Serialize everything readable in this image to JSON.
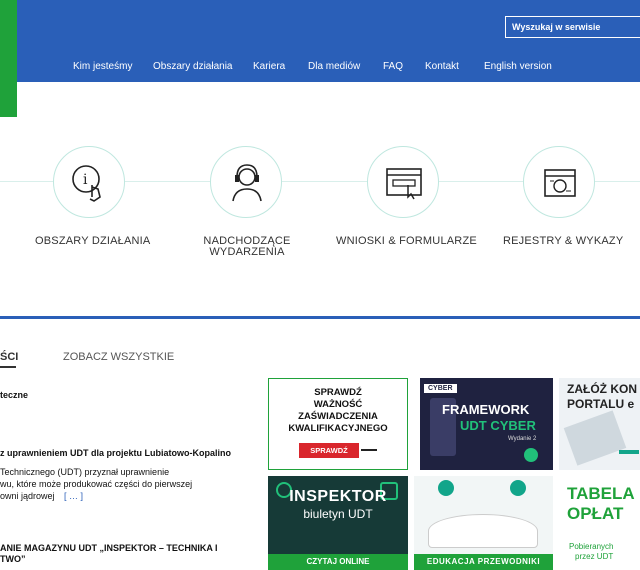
{
  "header": {
    "search_placeholder": "Wyszukaj w serwisie",
    "nav": [
      "Kim jesteśmy",
      "Obszary działania",
      "Kariera",
      "Dla mediów",
      "FAQ",
      "Kontakt",
      "English version"
    ]
  },
  "categories": [
    {
      "label_lines": [
        "OBSZARY DZIAŁANIA"
      ],
      "icon": "info-hand-icon"
    },
    {
      "label_lines": [
        "NADCHODZĄCE",
        "WYDARZENIA"
      ],
      "icon": "headset-person-icon"
    },
    {
      "label_lines": [
        "WNIOSKI & FORMULARZE"
      ],
      "icon": "browser-form-icon"
    },
    {
      "label_lines": [
        "REJESTRY & WYKAZY"
      ],
      "icon": "registry-icon"
    }
  ],
  "news": {
    "tab_active": "ŚCI",
    "tab_see_all": "ZOBACZ WSZYSTKIE",
    "items": [
      {
        "lines": [
          "teczne"
        ]
      },
      {
        "lines": [
          "z uprawnieniem UDT dla projektu Lubiatowo-Kopalino"
        ],
        "bold": true
      },
      {
        "lines": [
          "Technicznego (UDT) przyznał uprawnienie",
          "wu, które może produkować części do pierwszej",
          "owni jądrowej"
        ],
        "more": "[ … ]"
      },
      {
        "lines": [
          "ANIE MAGAZYNU UDT „INSPEKTOR – TECHNIKA I",
          "TWO”"
        ],
        "bold": true
      }
    ]
  },
  "tiles": {
    "verify": {
      "lines": [
        "SPRAWDŹ",
        "WAŻNOŚĆ",
        "ZAŚWIADCZENIA",
        "KWALIFIKACYJNEGO"
      ],
      "button": "SPRAWDŹ"
    },
    "cyber": {
      "tag": "CYBER",
      "title1": "FRAMEWORK",
      "title2": "UDT CYBER",
      "edition": "Wydanie 2"
    },
    "portal": {
      "lines": [
        "ZAŁÓŻ KON",
        "PORTALU e"
      ],
      "suffix": "e"
    },
    "inspektor": {
      "title": "INSPEKTOR",
      "subtitle": "biuletyn UDT",
      "button": "CZYTAJ ONLINE"
    },
    "education": {
      "label": "EDUKACJA PRZEWODNIKI"
    },
    "fees": {
      "title1": "TABELA",
      "title2": "OPŁAT",
      "sub1": "Pobieranych",
      "sub2": "przez UDT"
    }
  },
  "colors": {
    "brand_blue": "#2a5fb8",
    "brand_green": "#1fa23a",
    "teal": "#12a58a",
    "red": "#d9262c"
  }
}
